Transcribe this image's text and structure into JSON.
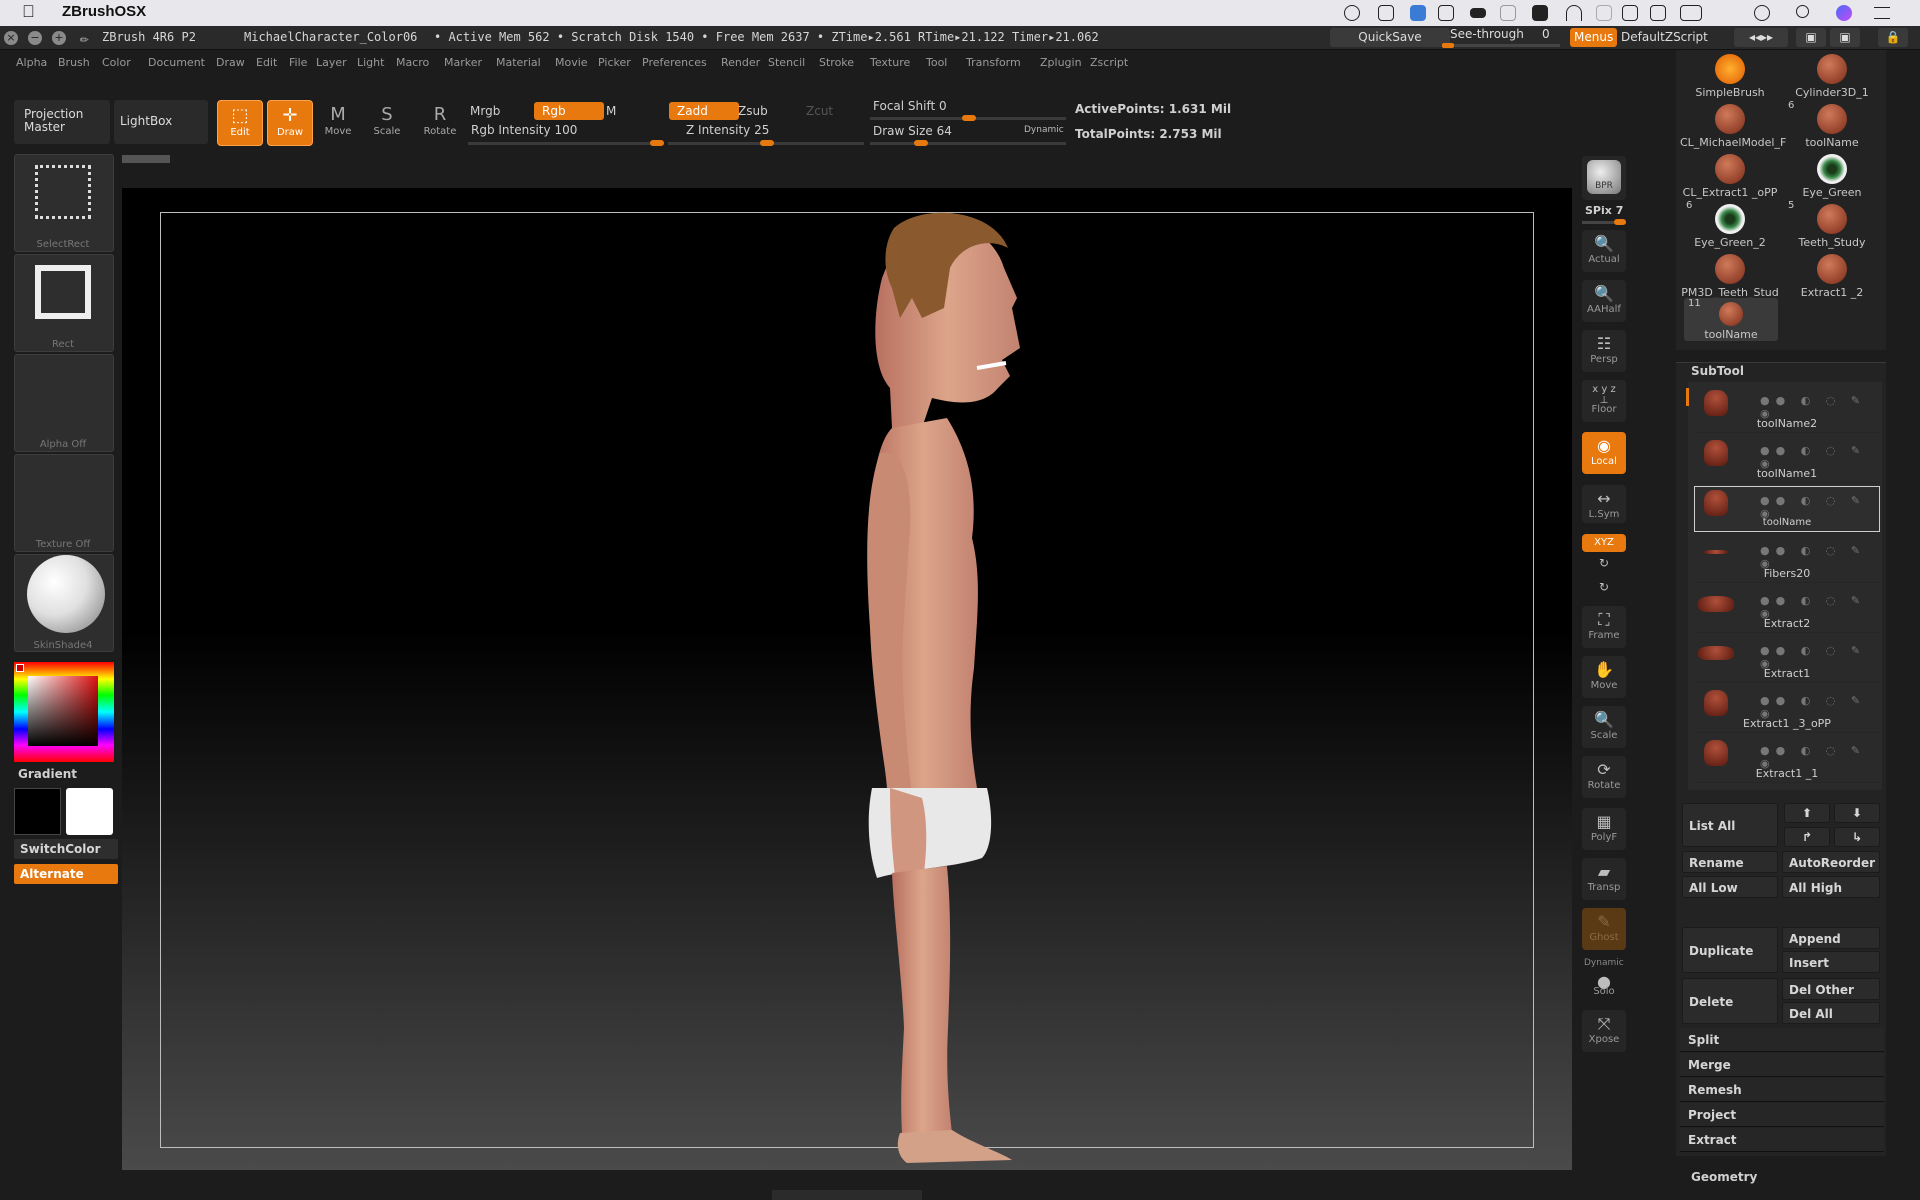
{
  "mac_menubar": {
    "app_name": "ZBrushOSX",
    "tray_icons": [
      "creative-cloud-icon",
      "checklist-icon",
      "dropbox-icon",
      "screen-icon",
      "battery-strip-icon",
      "drive-icon",
      "keyboard-icon",
      "wifi-icon",
      "disk-icon",
      "airplay-icon",
      "display-icon",
      "battery-icon",
      "clock-icon",
      "search-icon",
      "siri-icon",
      "list-icon"
    ]
  },
  "titlebar": {
    "version": "ZBrush 4R6 P2",
    "document": "MichaelCharacter_Color06",
    "stats": "• Active Mem 562 • Scratch Disk 1540 • Free Mem 2637 • ZTime▸2.561 RTime▸21.122 Timer▸21.062",
    "quicksave": "QuickSave",
    "see_through": "See-through",
    "see_through_value": "0",
    "menus": "Menus",
    "default_zscript": "DefaultZScript"
  },
  "menus": [
    "Alpha",
    "Brush",
    "Color",
    "Document",
    "Draw",
    "Edit",
    "File",
    "Layer",
    "Light",
    "Macro",
    "Marker",
    "Material",
    "Movie",
    "Picker",
    "Preferences",
    "Render",
    "Stencil",
    "Stroke",
    "Texture",
    "Tool",
    "Transform",
    "Zplugin",
    "Zscript"
  ],
  "toolbar": {
    "projection_master": "Projection Master",
    "lightbox": "LightBox",
    "edit": "Edit",
    "draw": "Draw",
    "move": "Move",
    "scale": "Scale",
    "rotate": "Rotate",
    "mrgb": "Mrgb",
    "rgb": "Rgb",
    "m": "M",
    "zadd": "Zadd",
    "zsub": "Zsub",
    "zcut": "Zcut",
    "rgb_intensity_label": "Rgb Intensity",
    "rgb_intensity": "100",
    "z_intensity_label": "Z Intensity",
    "z_intensity": "25",
    "focal_shift_label": "Focal Shift",
    "focal_shift": "0",
    "draw_size_label": "Draw Size",
    "draw_size": "64",
    "dynamic": "Dynamic",
    "active_points": "ActivePoints: 1.631  Mil",
    "total_points": "TotalPoints: 2.753  Mil"
  },
  "left_shelf": {
    "select_rect": "SelectRect",
    "rect": "Rect",
    "alpha": "Alpha  Off",
    "texture": "Texture  Off",
    "material": "SkinShade4",
    "gradient": "Gradient",
    "switch_color": "SwitchColor",
    "alternate": "Alternate",
    "primary_color": "#000000",
    "secondary_color": "#ffffff"
  },
  "right_shelf": {
    "bpr": "BPR",
    "spix_label": "SPix",
    "spix_value": "7",
    "actual": "Actual",
    "aahalf": "AAHalf",
    "persp": "Persp",
    "floor": "Floor",
    "local": "Local",
    "lsym": "L.Sym",
    "xyz": "XYZ",
    "frame": "Frame",
    "move": "Move",
    "scale": "Scale",
    "rotate": "Rotate",
    "polyf": "PolyF",
    "transp": "Transp",
    "ghost": "Ghost",
    "dynamic": "Dynamic",
    "solo": "Solo",
    "xpose": "Xpose"
  },
  "tool_palette": {
    "items": [
      {
        "name": "SimpleBrush",
        "badge": ""
      },
      {
        "name": "Cylinder3D_1",
        "badge": ""
      },
      {
        "name": "CL_MichaelModel_F",
        "badge": ""
      },
      {
        "name": "toolName",
        "badge": "6"
      },
      {
        "name": "CL_Extract1 _oPP",
        "badge": ""
      },
      {
        "name": "Eye_Green",
        "badge": ""
      },
      {
        "name": "Eye_Green_2",
        "badge": "6"
      },
      {
        "name": "Teeth_Study",
        "badge": "5"
      },
      {
        "name": "PM3D_Teeth_Stud",
        "badge": ""
      },
      {
        "name": "Extract1 _2",
        "badge": ""
      },
      {
        "name": "toolName",
        "badge": "11"
      }
    ]
  },
  "subtool": {
    "header": "SubTool",
    "rows": [
      {
        "name": "toolName2"
      },
      {
        "name": "toolName1"
      },
      {
        "name": "toolName"
      },
      {
        "name": "Fibers20"
      },
      {
        "name": "Extract2"
      },
      {
        "name": "Extract1"
      },
      {
        "name": "Extract1 _3_oPP"
      },
      {
        "name": "Extract1 _1"
      }
    ],
    "list_all": "List  All",
    "rename": "Rename",
    "auto_reorder": "AutoReorder",
    "all_low": "All Low",
    "all_high": "All High",
    "duplicate": "Duplicate",
    "append": "Append",
    "insert": "Insert",
    "delete": "Delete",
    "del_other": "Del Other",
    "del_all": "Del All",
    "split": "Split",
    "merge": "Merge",
    "remesh": "Remesh",
    "project": "Project",
    "extract": "Extract",
    "geometry": "Geometry"
  }
}
